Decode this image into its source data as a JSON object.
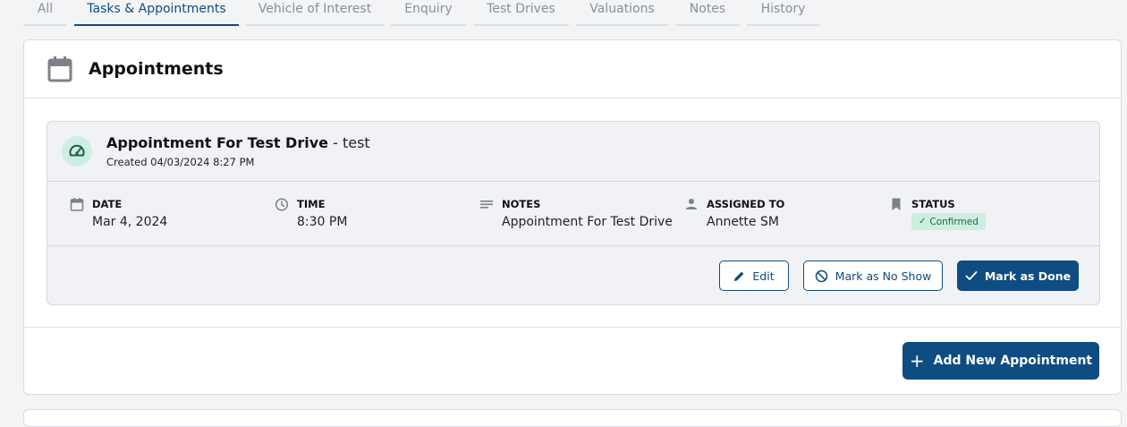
{
  "tabs": [
    {
      "label": "All"
    },
    {
      "label": "Tasks & Appointments"
    },
    {
      "label": "Vehicle of Interest"
    },
    {
      "label": "Enquiry"
    },
    {
      "label": "Test Drives"
    },
    {
      "label": "Valuations"
    },
    {
      "label": "Notes"
    },
    {
      "label": "History"
    }
  ],
  "active_tab": "Tasks & Appointments",
  "panel": {
    "title": "Appointments",
    "icon": "calendar-icon"
  },
  "appointment": {
    "title": "Appointment For Test Drive",
    "title_suffix": " - test",
    "created": "Created 04/03/2024 8:27 PM",
    "icon": "speedometer-icon",
    "fields": {
      "date": {
        "label": "DATE",
        "value": "Mar 4, 2024",
        "icon": "calendar-icon"
      },
      "time": {
        "label": "TIME",
        "value": "8:30 PM",
        "icon": "clock-icon"
      },
      "notes": {
        "label": "NOTES",
        "value": "Appointment For Test Drive",
        "icon": "notes-icon"
      },
      "assigned": {
        "label": "ASSIGNED TO",
        "value": "Annette SM",
        "icon": "person-icon"
      },
      "status": {
        "label": "STATUS",
        "value": "Confirmed",
        "icon": "bookmark-icon"
      }
    },
    "actions": {
      "edit": "Edit",
      "no_show": "Mark as No Show",
      "done": "Mark as Done"
    }
  },
  "add_button": "Add New Appointment",
  "colors": {
    "primary": "#0f4c81",
    "status_bg": "#cdeee0",
    "status_text": "#1f6a46",
    "icon_bg": "#cfeee3"
  }
}
